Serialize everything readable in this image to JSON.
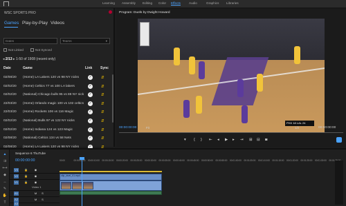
{
  "workspaces": {
    "learning": "Learning",
    "assembly": "Assembly",
    "editing": "Editing",
    "color": "Color",
    "effects": "Effects",
    "audio": "Audio",
    "graphics": "Graphics",
    "libraries": "Libraries"
  },
  "left_panel": {
    "title": "WSC SPORTS PRO",
    "tabs": [
      "Games",
      "Play-by-Play",
      "Videos"
    ],
    "dates_placeholder": "Dates",
    "teams_placeholder": "Teams",
    "not_linked": "Not Linked",
    "not_synced": "Not Synced",
    "page": "2/13",
    "range": "1-50 of 1908 (recent only)",
    "columns": {
      "date": "Date",
      "game": "Game",
      "link": "Link",
      "sync": "Sync"
    },
    "rows": [
      {
        "date": "02/08/20",
        "game": "(Home) LA Lakers 120 vs 98 NY nicks"
      },
      {
        "date": "02/02/20",
        "game": "(Home) Celtics 77 vs 100 LA lakers"
      },
      {
        "date": "02/02/20",
        "game": "(National) Chicago bulls 95 vs 88 NY nick"
      },
      {
        "date": "22/03/20",
        "game": "(Home) Orlando magic 100 vs 102 celtics"
      },
      {
        "date": "22/03/20",
        "game": "(Home) Rockets 106 vs 116 Magic"
      },
      {
        "date": "02/02/20",
        "game": "(National) Bulls 97 vs 122 NY nicks"
      },
      {
        "date": "02/02/20",
        "game": "(Home) Indiana 124 vs 123 Magic"
      },
      {
        "date": "02/08/20",
        "game": "(National) Celtics 134 vs 58 Nets"
      },
      {
        "date": "02/08/20",
        "game": "(Home) LA Lakers 120 vs 98 NY nicks"
      }
    ]
  },
  "program": {
    "title": "Program: Duels by Dwight Howard",
    "timecode": "00:00:00:00",
    "fit": "Fit",
    "ratio": "1/2",
    "end_timecode": "00:00:00:00",
    "scorebug": "PHX 18  LAL 24"
  },
  "timeline": {
    "sequence_tab": "Sequence 6 ThuTube",
    "timecode": "00:00:00:00",
    "ruler": [
      "00:00",
      "00:00:05:00",
      "00:00:10:00",
      "00:00:15:00",
      "00:00:20:00",
      "00:00:25:00",
      "00:00:30:00",
      "00:00:35:00",
      "00:00:40:00",
      "00:00:45:00",
      "00:00:50:00",
      "00:00:55:00",
      "00:01:00:00",
      "00:01:05:00",
      "00:01:10:00",
      "00:01:15:00",
      "00:01:20:00",
      "00:01:25:00",
      "00:01:30:00",
      "00:01:35:00"
    ],
    "track_labels": {
      "v3": "V3",
      "v2": "V2",
      "v1": "V1",
      "a1": "A1",
      "a2": "A2",
      "a3": "A3"
    },
    "clip_label": "clip_duel_01.mp4",
    "video1_label": "Video 1"
  }
}
